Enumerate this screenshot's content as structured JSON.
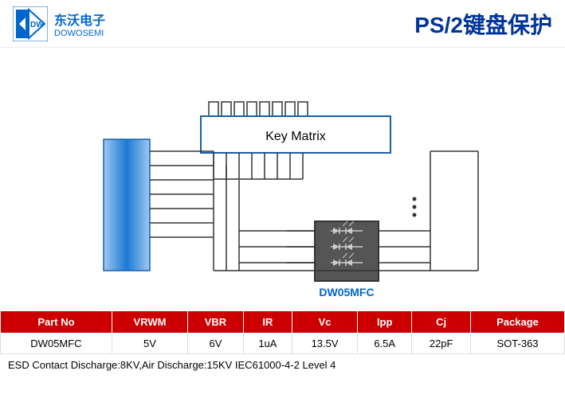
{
  "header": {
    "company_cn": "东沃电子",
    "company_en": "DOWOSEMI",
    "title": "PS/2键盘保护"
  },
  "diagram": {
    "key_matrix_label": "Key Matrix",
    "component_label": "DW05MFC"
  },
  "table": {
    "headers": [
      "Part No",
      "VRWM",
      "VBR",
      "IR",
      "Vc",
      "Ipp",
      "Cj",
      "Package"
    ],
    "rows": [
      [
        "DW05MFC",
        "5V",
        "6V",
        "1uA",
        "13.5V",
        "6.5A",
        "22pF",
        "SOT-363"
      ]
    ]
  },
  "footer": {
    "text": "ESD Contact Discharge:8KV,Air Discharge:15KV  IEC61000-4-2 Level 4"
  }
}
